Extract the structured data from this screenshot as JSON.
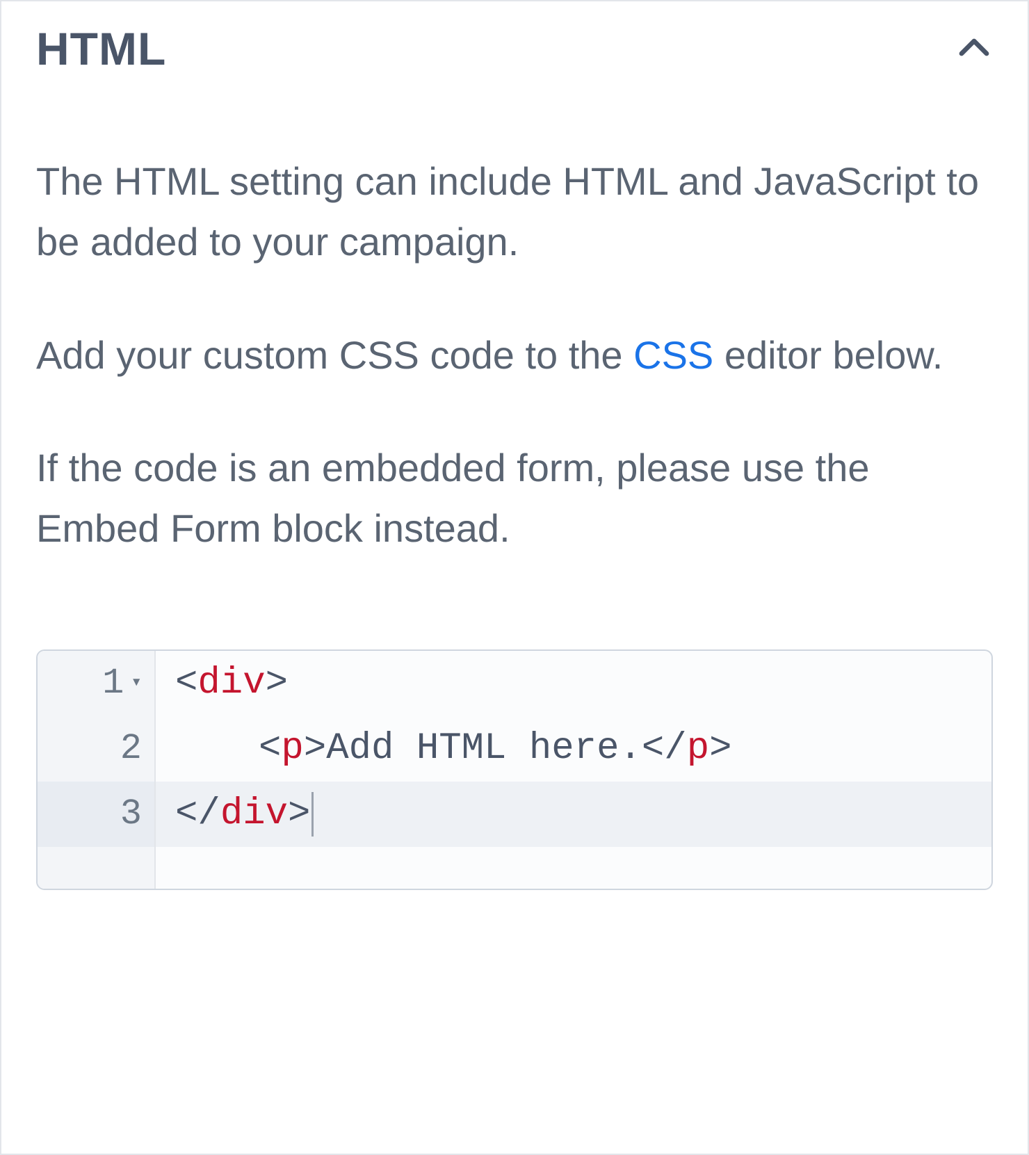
{
  "header": {
    "title": "HTML"
  },
  "body": {
    "p1": "The HTML setting can include HTML and JavaScript to be added to your campaign.",
    "p2_pre": "Add your custom CSS code to the ",
    "p2_link": "CSS",
    "p2_post": " editor below.",
    "p3": "If the code is an embedded form, please use the Embed Form block instead."
  },
  "editor": {
    "lines": [
      {
        "num": "1",
        "fold": true,
        "indent": 0,
        "segments": [
          {
            "t": "punc",
            "v": "<"
          },
          {
            "t": "tag",
            "v": "div"
          },
          {
            "t": "punc",
            "v": ">"
          }
        ]
      },
      {
        "num": "2",
        "fold": false,
        "indent": 1,
        "segments": [
          {
            "t": "punc",
            "v": "<"
          },
          {
            "t": "tag",
            "v": "p"
          },
          {
            "t": "punc",
            "v": ">"
          },
          {
            "t": "text",
            "v": "Add HTML here."
          },
          {
            "t": "punc",
            "v": "</"
          },
          {
            "t": "tag",
            "v": "p"
          },
          {
            "t": "punc",
            "v": ">"
          }
        ]
      },
      {
        "num": "3",
        "fold": false,
        "indent": 0,
        "active": true,
        "cursor": true,
        "segments": [
          {
            "t": "punc",
            "v": "</"
          },
          {
            "t": "tag",
            "v": "div"
          },
          {
            "t": "punc",
            "v": ">"
          }
        ]
      }
    ]
  }
}
